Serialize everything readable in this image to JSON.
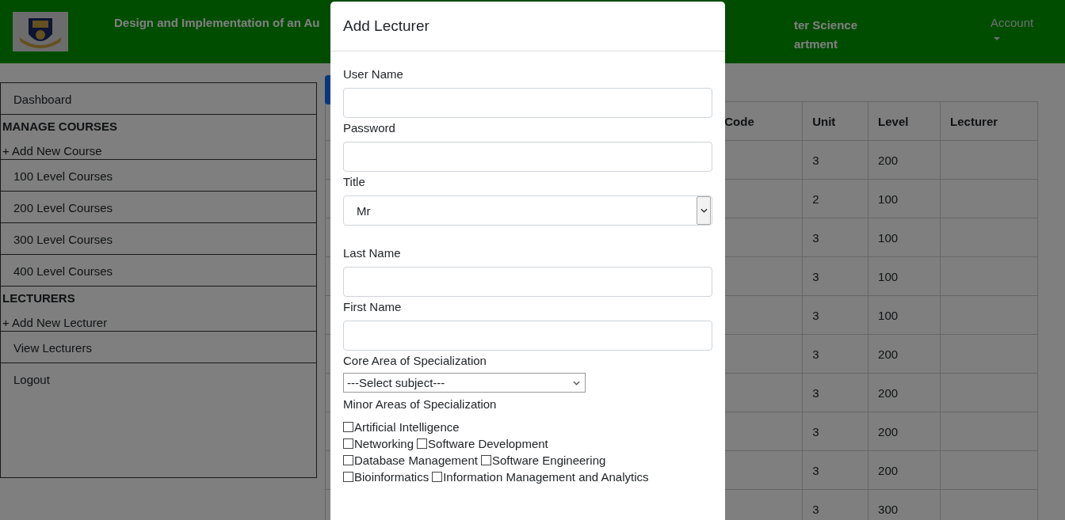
{
  "header": {
    "title_left": "Design and Implementation of an Au",
    "title_right": [
      "ter Science",
      "artment"
    ],
    "account": "Account"
  },
  "sidebar": [
    {
      "kind": "link",
      "label": "Dashboard"
    },
    {
      "kind": "heading",
      "label": "MANAGE COURSES"
    },
    {
      "kind": "add",
      "label": "+ Add New Course"
    },
    {
      "kind": "link",
      "label": "100 Level Courses"
    },
    {
      "kind": "link",
      "label": "200 Level Courses"
    },
    {
      "kind": "link",
      "label": "300 Level Courses"
    },
    {
      "kind": "link",
      "label": "400 Level Courses"
    },
    {
      "kind": "heading",
      "label": "LECTURERS"
    },
    {
      "kind": "add",
      "label": "+ Add New Lecturer"
    },
    {
      "kind": "link",
      "label": "View Lecturers"
    },
    {
      "kind": "logout",
      "label": "Logout"
    }
  ],
  "table": {
    "columns": [
      "Code",
      "Unit",
      "Level",
      "Lecturer"
    ],
    "rows": [
      [
        "",
        "3",
        "200",
        ""
      ],
      [
        "",
        "2",
        "100",
        ""
      ],
      [
        "",
        "3",
        "100",
        ""
      ],
      [
        "",
        "3",
        "100",
        ""
      ],
      [
        "",
        "3",
        "100",
        ""
      ],
      [
        "",
        "3",
        "200",
        ""
      ],
      [
        "",
        "3",
        "200",
        ""
      ],
      [
        "",
        "3",
        "200",
        ""
      ],
      [
        "",
        "3",
        "200",
        ""
      ],
      [
        "",
        "3",
        "300",
        ""
      ]
    ]
  },
  "modal": {
    "title": "Add Lecturer",
    "fields": [
      {
        "kind": "text",
        "label": "User Name"
      },
      {
        "kind": "password",
        "label": "Password"
      },
      {
        "kind": "select",
        "label": "Title",
        "value": "Mr"
      },
      {
        "kind": "text",
        "label": "Last Name"
      },
      {
        "kind": "text",
        "label": "First Name"
      },
      {
        "kind": "small-select",
        "label": "Core Area of Specialization",
        "value": "---Select subject---"
      }
    ],
    "minor_label": "Minor Areas of Specialization",
    "minor_rows": [
      [
        {
          "label": "Artificial Intelligence",
          "checked": false
        }
      ],
      [
        {
          "label": "Networking",
          "checked": false
        },
        {
          "label": "Software Development",
          "checked": false
        }
      ],
      [
        {
          "label": "Database Management",
          "checked": false
        },
        {
          "label": "Software Engineering",
          "checked": false
        }
      ],
      [
        {
          "label": "Bioinformatics",
          "checked": false
        },
        {
          "label": "Information Management and Analytics",
          "checked": false
        }
      ]
    ]
  }
}
